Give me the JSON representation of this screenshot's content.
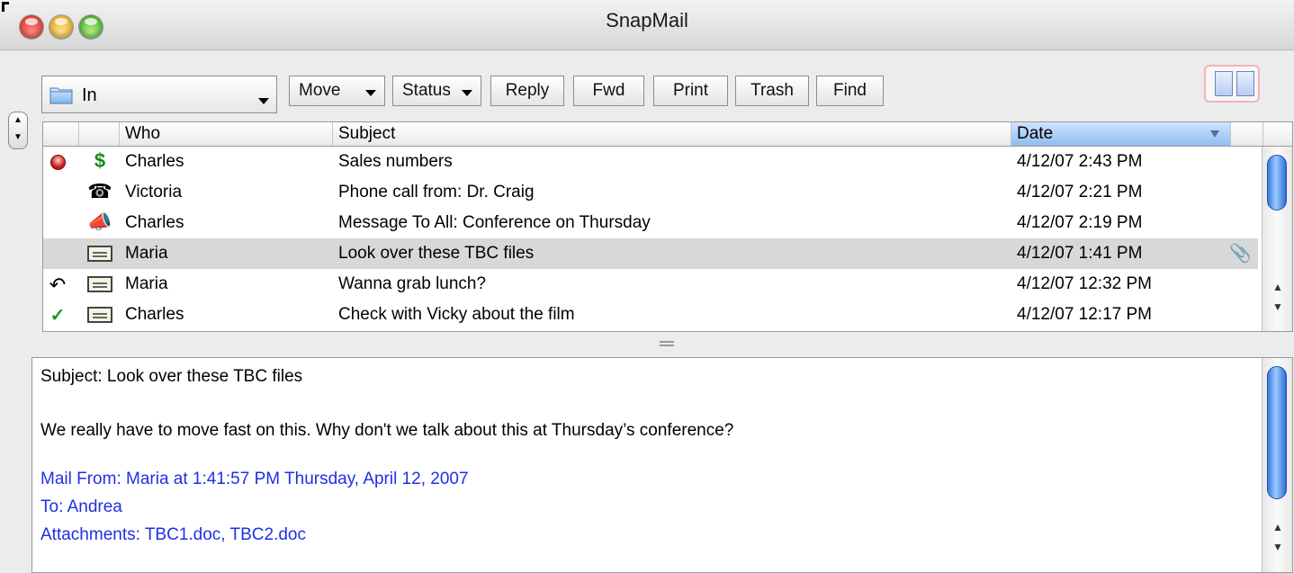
{
  "window": {
    "title": "SnapMail"
  },
  "mailbox": {
    "selected": "In"
  },
  "toolbar": {
    "move": "Move",
    "status": "Status",
    "reply": "Reply",
    "fwd": "Fwd",
    "print": "Print",
    "trash": "Trash",
    "find": "Find"
  },
  "columns": {
    "who": "Who",
    "subject": "Subject",
    "date": "Date"
  },
  "messages": [
    {
      "who": "Charles",
      "subject": "Sales numbers",
      "date": "4/12/07 2:43 PM",
      "status_icon": "red-dot-icon",
      "type_icon": "dollar-icon"
    },
    {
      "who": "Victoria",
      "subject": "Phone call from: Dr. Craig",
      "date": "4/12/07 2:21 PM",
      "status_icon": "",
      "type_icon": "phone-icon"
    },
    {
      "who": "Charles",
      "subject": "Message To All: Conference on Thursday",
      "date": "4/12/07 2:19 PM",
      "status_icon": "",
      "type_icon": "megaphone-icon"
    },
    {
      "who": "Maria",
      "subject": "Look over these TBC files",
      "date": "4/12/07 1:41 PM",
      "status_icon": "",
      "type_icon": "memo-icon",
      "attachment": true
    },
    {
      "who": "Maria",
      "subject": "Wanna grab lunch?",
      "date": "4/12/07 12:32 PM",
      "status_icon": "reply-arrow-icon",
      "type_icon": "memo-icon"
    },
    {
      "who": "Charles",
      "subject": "Check with Vicky about the film",
      "date": "4/12/07 12:17 PM",
      "status_icon": "checkmark-icon",
      "type_icon": "memo-icon"
    }
  ],
  "selected_index": 3,
  "preview": {
    "subject_line": "Subject: Look over these TBC files",
    "body": "We really have to move fast on this.  Why don't we talk about this at Thursday’s conference?",
    "from_line": "Mail From: Maria at 1:41:57 PM Thursday, April 12, 2007",
    "to_line": "To: Andrea",
    "attachments_line": "Attachments:  TBC1.doc, TBC2.doc"
  },
  "colors": {
    "selection": "#d8d8d8",
    "sorted_header": "#8fbcf2",
    "meta_text": "#1f2fe6",
    "attachment_clip": "#d01818"
  }
}
